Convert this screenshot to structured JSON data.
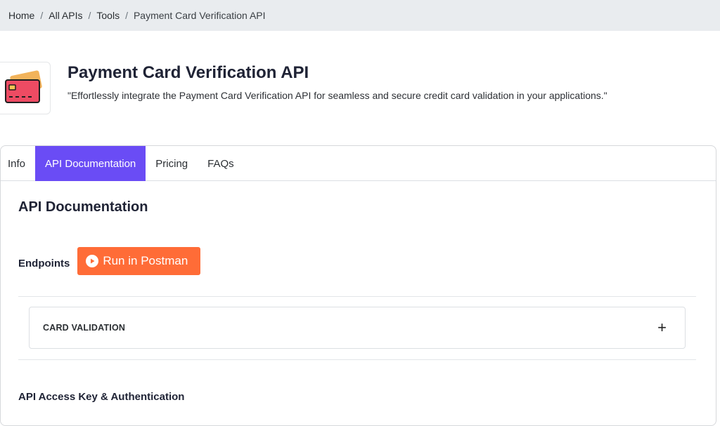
{
  "breadcrumb": {
    "items": [
      "Home",
      "All APIs",
      "Tools",
      "Payment Card Verification API"
    ],
    "separator": "/"
  },
  "header": {
    "title": "Payment Card Verification API",
    "description": "\"Effortlessly integrate the Payment Card Verification API for seamless and secure credit card validation in your applications.\"",
    "logo_icon": "credit-card-icon"
  },
  "tabs": [
    {
      "label": "Info",
      "active": false
    },
    {
      "label": "API Documentation",
      "active": true
    },
    {
      "label": "Pricing",
      "active": false
    },
    {
      "label": "FAQs",
      "active": false
    }
  ],
  "documentation": {
    "title": "API Documentation",
    "endpoints_label": "Endpoints",
    "postman_button": "Run in Postman",
    "sections": [
      {
        "title": "CARD VALIDATION",
        "expanded": false,
        "toggle_icon": "plus-icon"
      }
    ],
    "auth_title": "API Access Key & Authentication"
  },
  "colors": {
    "accent": "#6a4cf5",
    "postman": "#ff6c37",
    "breadcrumb_bg": "#e9ecef"
  }
}
